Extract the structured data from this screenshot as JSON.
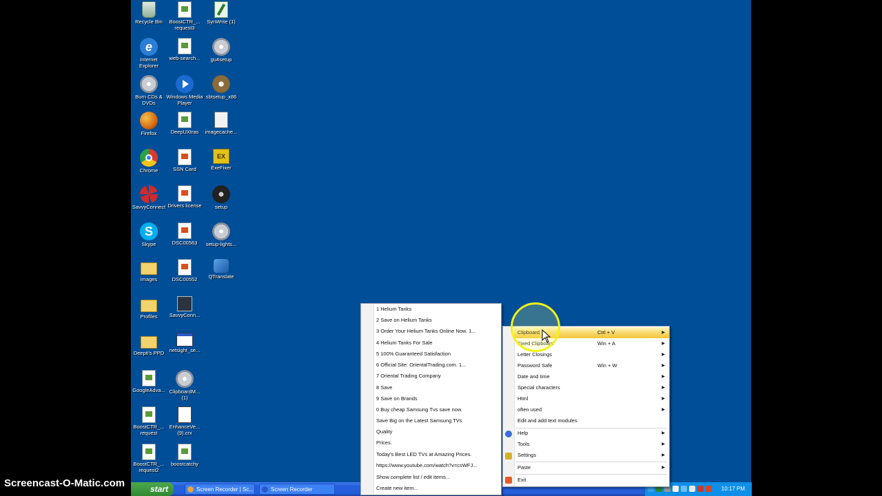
{
  "desktop_icons": [
    {
      "label": "Recycle Bin",
      "icon": "recycle-bin-icon"
    },
    {
      "label": "BoostCTR_... request3",
      "icon": "document-icon"
    },
    {
      "label": "SynWrite (1)",
      "icon": "editor-icon"
    },
    {
      "label": "Internet Explorer",
      "icon": "internet-explorer-icon"
    },
    {
      "label": "web-search...",
      "icon": "program-icon"
    },
    {
      "label": "gu4setup",
      "icon": "setup-icon"
    },
    {
      "label": "Burn CDs & DVDs",
      "icon": "cd-icon"
    },
    {
      "label": "Windows Media Player",
      "icon": "media-player-icon"
    },
    {
      "label": "sbtsetup_x86",
      "icon": "setup-icon"
    },
    {
      "label": "Firefox",
      "icon": "firefox-icon"
    },
    {
      "label": "DeepUXtras",
      "icon": "document-icon"
    },
    {
      "label": "imagecache...",
      "icon": "archive-icon"
    },
    {
      "label": "Chrome",
      "icon": "chrome-icon"
    },
    {
      "label": "SSN Card",
      "icon": "document-icon"
    },
    {
      "label": "ExeFixer",
      "icon": "exefixer-icon"
    },
    {
      "label": "SavvyConnect",
      "icon": "savvyconnect-icon"
    },
    {
      "label": "Drivers license",
      "icon": "document-icon"
    },
    {
      "label": "setup",
      "icon": "disc-icon"
    },
    {
      "label": "Skype",
      "icon": "skype-icon"
    },
    {
      "label": "DSC00563",
      "icon": "image-file-icon"
    },
    {
      "label": "setup-lights...",
      "icon": "setup-icon"
    },
    {
      "label": "Images",
      "icon": "folder-icon"
    },
    {
      "label": "DSC00552",
      "icon": "image-file-icon"
    },
    {
      "label": "QTranslate",
      "icon": "qtranslate-icon"
    },
    {
      "label": "Profiles",
      "icon": "folder-icon"
    },
    {
      "label": "SavvyConn...",
      "icon": "scanner-icon"
    },
    {
      "label": "Deepti's PPD",
      "icon": "folder-icon"
    },
    {
      "label": "netsight_se...",
      "icon": "window-icon"
    },
    {
      "label": "GoogleAdva...",
      "icon": "document-icon"
    },
    {
      "label": "ClipboardM... (1)",
      "icon": "setup-icon"
    },
    {
      "label": "BoostCTR_... request",
      "icon": "document-icon"
    },
    {
      "label": "EnhanceVe... (9).crx",
      "icon": "crx-file-icon"
    },
    {
      "label": "BoostCTR_... request2",
      "icon": "document-icon"
    },
    {
      "label": "boostcatchy",
      "icon": "document-icon"
    }
  ],
  "taskbar": {
    "start_label": "start",
    "buttons": [
      "Screen Recorder | Sc...",
      "Screen Recorder"
    ],
    "clock": "10:17 PM"
  },
  "watermark": "Screencast-O-Matic.com",
  "clip_list_menu": {
    "items": [
      "1 Helium Tanks",
      "2 Save on Helium Tanks",
      "3 Order Your Helium Tanks Online Now. 1...",
      "4 Helium Tanks For Sale",
      "5 100% Guaranteed Satisfaction",
      "6 Official Site: OrientalTrading.com. 1...",
      "7 Oriental Trading Company",
      "8 Save",
      "9 Save on Brands",
      "0 Buy cheap Samsung Tvs  save now.",
      "Save Big on the Latest Samsung TVs",
      "Quality",
      "Prices.",
      "Today's Best LED TVs at Amazing Prices.",
      "https://www.youtube.com/watch?v=csWFJ...",
      "Show complete list / edit items...",
      "Create new item..."
    ]
  },
  "main_menu": {
    "items": [
      {
        "label": "Clipboard",
        "shortcut": "Ctrl + V",
        "submenu": true,
        "highlighted": true
      },
      {
        "label": "Fixed Clipboard",
        "shortcut": "Win + A",
        "submenu": true
      },
      {
        "label": "Letter Closings",
        "shortcut": "",
        "submenu": true
      },
      {
        "label": "Password Safe",
        "shortcut": "Win + W",
        "submenu": true
      },
      {
        "label": "Date and time",
        "shortcut": "",
        "submenu": true
      },
      {
        "label": "Special characters",
        "shortcut": "",
        "submenu": true
      },
      {
        "label": "Html",
        "shortcut": "",
        "submenu": true
      },
      {
        "label": "often used",
        "shortcut": "",
        "submenu": true
      },
      {
        "label": "Edit and add text modules",
        "shortcut": "",
        "submenu": false
      },
      {
        "label": "Help",
        "shortcut": "",
        "submenu": true
      },
      {
        "label": "Tools",
        "shortcut": "",
        "submenu": true
      },
      {
        "label": "Settings",
        "shortcut": "",
        "submenu": true
      },
      {
        "label": "Paste",
        "shortcut": "",
        "submenu": true
      },
      {
        "label": "Exit",
        "shortcut": "",
        "submenu": false
      }
    ],
    "arrow": "▶"
  },
  "colors": {
    "desktop": "#004e98",
    "taskbar": "#245edb",
    "start_button": "#3c8f3c",
    "menu_highlight": "#f8d766",
    "focus_ring": "#f2f216"
  }
}
